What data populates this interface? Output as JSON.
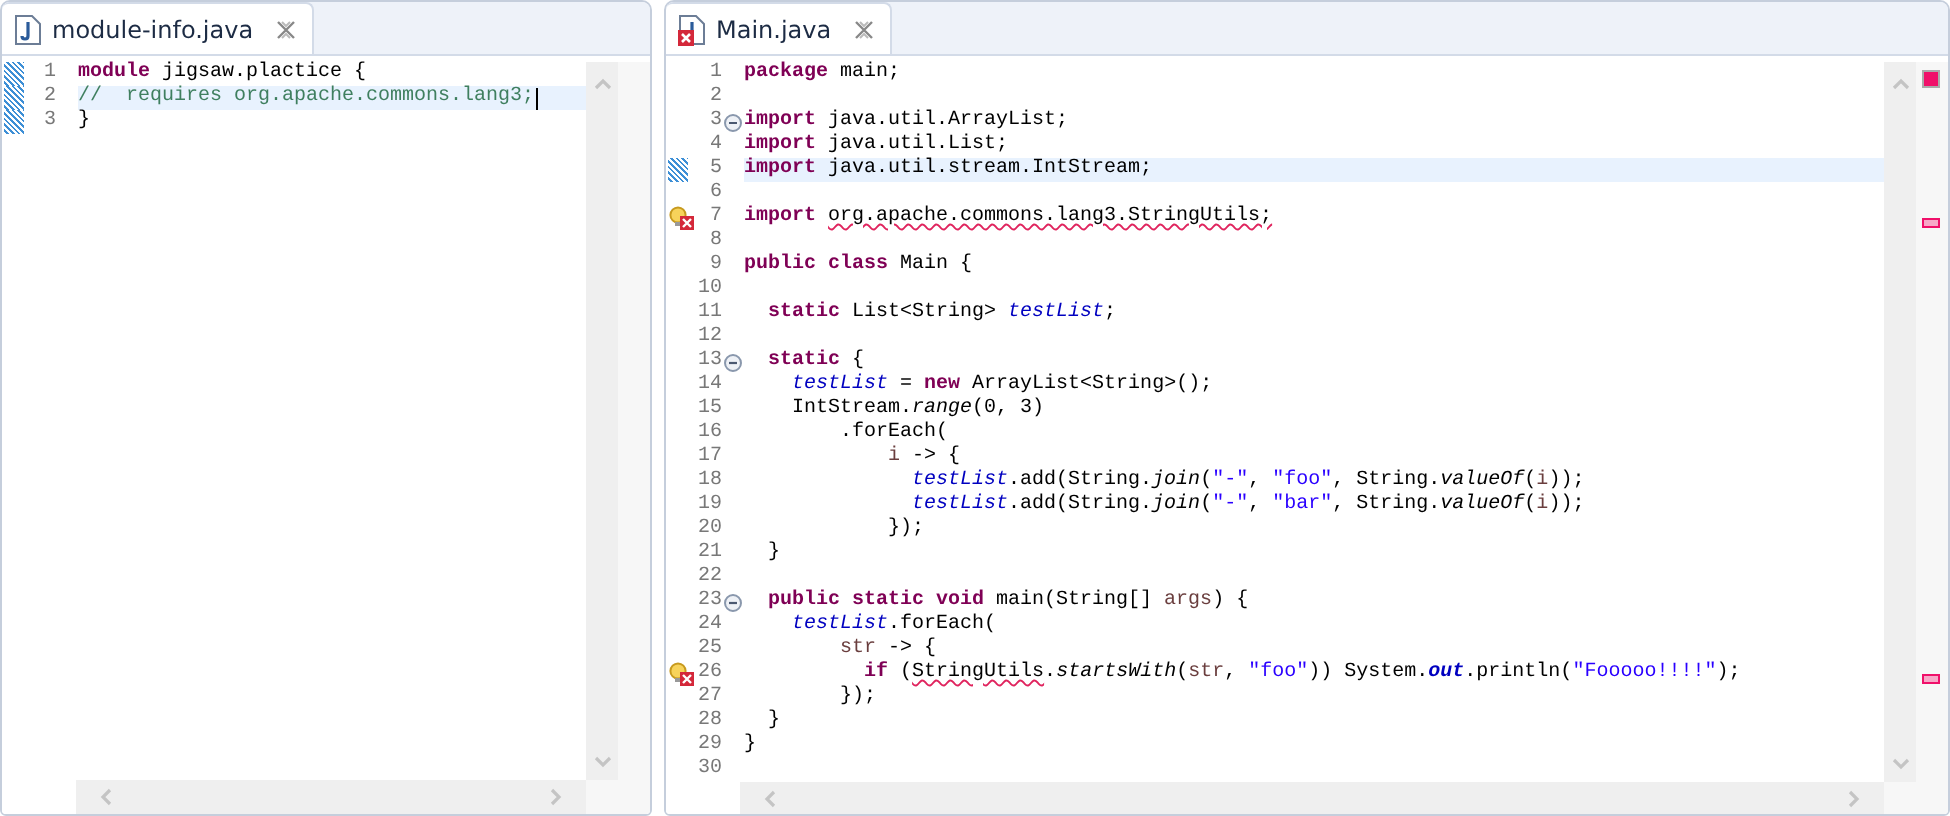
{
  "editors": [
    {
      "tab": {
        "title": "module-info.java",
        "has_error": false
      },
      "focused": true,
      "lines": [
        {
          "number": "1",
          "changed": true,
          "has_error": false,
          "fold": false,
          "current": false,
          "tokens": [
            {
              "text": "module",
              "kind": "keyword"
            },
            {
              "text": " jigsaw.plactice {",
              "kind": "plain"
            }
          ]
        },
        {
          "number": "2",
          "changed": true,
          "has_error": false,
          "fold": false,
          "current": true,
          "tokens": [
            {
              "text": "//  requires org.apache.commons.lang3;",
              "kind": "comment"
            }
          ]
        },
        {
          "number": "3",
          "changed": true,
          "has_error": false,
          "fold": false,
          "current": false,
          "tokens": [
            {
              "text": "}",
              "kind": "plain"
            }
          ]
        }
      ]
    },
    {
      "tab": {
        "title": "Main.java",
        "has_error": true
      },
      "focused": false,
      "lines": [
        {
          "number": "1",
          "changed": false,
          "has_error": false,
          "fold": false,
          "current": false,
          "tokens": [
            {
              "text": "package",
              "kind": "keyword"
            },
            {
              "text": " main;",
              "kind": "plain"
            }
          ]
        },
        {
          "number": "2",
          "changed": false,
          "has_error": false,
          "fold": false,
          "current": false
        },
        {
          "number": "3",
          "changed": false,
          "has_error": false,
          "fold": true,
          "current": false,
          "tokens": [
            {
              "text": "import",
              "kind": "keyword"
            },
            {
              "text": " java.util.ArrayList;",
              "kind": "plain"
            }
          ]
        },
        {
          "number": "4",
          "changed": false,
          "has_error": false,
          "fold": false,
          "current": false,
          "tokens": [
            {
              "text": "import",
              "kind": "keyword"
            },
            {
              "text": " java.util.List;",
              "kind": "plain"
            }
          ]
        },
        {
          "number": "5",
          "changed": true,
          "has_error": false,
          "fold": false,
          "current": true,
          "tokens": [
            {
              "text": "import",
              "kind": "keyword"
            },
            {
              "text": " java.util.stream.IntStream;",
              "kind": "plain"
            }
          ]
        },
        {
          "number": "6",
          "changed": false,
          "has_error": false,
          "fold": false,
          "current": false
        },
        {
          "number": "7",
          "changed": false,
          "has_error": true,
          "fold": false,
          "current": false,
          "tokens": [
            {
              "text": "import ",
              "kind": "keyword"
            },
            {
              "text": "org.apache.commons.lang3.StringUtils;",
              "kind": "error"
            }
          ]
        },
        {
          "number": "8",
          "changed": false,
          "has_error": false,
          "fold": false,
          "current": false
        },
        {
          "number": "9",
          "changed": false,
          "has_error": false,
          "fold": false,
          "current": false,
          "tokens": [
            {
              "text": "public class",
              "kind": "keyword"
            },
            {
              "text": " Main {",
              "kind": "plain"
            }
          ]
        },
        {
          "number": "10",
          "changed": false,
          "has_error": false,
          "fold": false,
          "current": false
        },
        {
          "number": "11",
          "changed": false,
          "has_error": false,
          "fold": false,
          "current": false,
          "tokens": [
            {
              "text": "  static",
              "kind": "keyword"
            },
            {
              "text": " List<String> ",
              "kind": "plain"
            },
            {
              "text": "testList",
              "kind": "field"
            },
            {
              "text": ";",
              "kind": "plain"
            }
          ]
        },
        {
          "number": "12",
          "changed": false,
          "has_error": false,
          "fold": false,
          "current": false
        },
        {
          "number": "13",
          "changed": false,
          "has_error": false,
          "fold": true,
          "current": false,
          "tokens": [
            {
              "text": "  static",
              "kind": "keyword"
            },
            {
              "text": " {",
              "kind": "plain"
            }
          ]
        },
        {
          "number": "14",
          "changed": false,
          "has_error": false,
          "fold": false,
          "current": false,
          "tokens": [
            {
              "text": "    testList",
              "kind": "field"
            },
            {
              "text": " = ",
              "kind": "plain"
            },
            {
              "text": "new",
              "kind": "keyword"
            },
            {
              "text": " ArrayList<String>();",
              "kind": "plain"
            }
          ]
        },
        {
          "number": "15",
          "changed": false,
          "has_error": false,
          "fold": false,
          "current": false,
          "tokens": [
            {
              "text": "    IntStream.",
              "kind": "plain"
            },
            {
              "text": "range",
              "kind": "static"
            },
            {
              "text": "(0, 3)",
              "kind": "plain"
            }
          ]
        },
        {
          "number": "16",
          "changed": false,
          "has_error": false,
          "fold": false,
          "current": false,
          "tokens": [
            {
              "text": "        .forEach(",
              "kind": "plain"
            }
          ]
        },
        {
          "number": "17",
          "changed": false,
          "has_error": false,
          "fold": false,
          "current": false,
          "tokens": [
            {
              "text": "            i",
              "kind": "local"
            },
            {
              "text": " -> {",
              "kind": "plain"
            }
          ]
        },
        {
          "number": "18",
          "changed": false,
          "has_error": false,
          "fold": false,
          "current": false,
          "tokens": [
            {
              "text": "              testList",
              "kind": "field"
            },
            {
              "text": ".add(String.",
              "kind": "plain"
            },
            {
              "text": "join",
              "kind": "static"
            },
            {
              "text": "(",
              "kind": "plain"
            },
            {
              "text": "\"-\"",
              "kind": "string"
            },
            {
              "text": ", ",
              "kind": "plain"
            },
            {
              "text": "\"foo\"",
              "kind": "string"
            },
            {
              "text": ", String.",
              "kind": "plain"
            },
            {
              "text": "valueOf",
              "kind": "static"
            },
            {
              "text": "(",
              "kind": "plain"
            },
            {
              "text": "i",
              "kind": "local"
            },
            {
              "text": "));",
              "kind": "plain"
            }
          ]
        },
        {
          "number": "19",
          "changed": false,
          "has_error": false,
          "fold": false,
          "current": false,
          "tokens": [
            {
              "text": "              testList",
              "kind": "field"
            },
            {
              "text": ".add(String.",
              "kind": "plain"
            },
            {
              "text": "join",
              "kind": "static"
            },
            {
              "text": "(",
              "kind": "plain"
            },
            {
              "text": "\"-\"",
              "kind": "string"
            },
            {
              "text": ", ",
              "kind": "plain"
            },
            {
              "text": "\"bar\"",
              "kind": "string"
            },
            {
              "text": ", String.",
              "kind": "plain"
            },
            {
              "text": "valueOf",
              "kind": "static"
            },
            {
              "text": "(",
              "kind": "plain"
            },
            {
              "text": "i",
              "kind": "local"
            },
            {
              "text": "));",
              "kind": "plain"
            }
          ]
        },
        {
          "number": "20",
          "changed": false,
          "has_error": false,
          "fold": false,
          "current": false,
          "tokens": [
            {
              "text": "            });",
              "kind": "plain"
            }
          ]
        },
        {
          "number": "21",
          "changed": false,
          "has_error": false,
          "fold": false,
          "current": false,
          "tokens": [
            {
              "text": "  }",
              "kind": "plain"
            }
          ]
        },
        {
          "number": "22",
          "changed": false,
          "has_error": false,
          "fold": false,
          "current": false
        },
        {
          "number": "23",
          "changed": false,
          "has_error": false,
          "fold": true,
          "current": false,
          "tokens": [
            {
              "text": "  public static void",
              "kind": "keyword"
            },
            {
              "text": " main(String[] ",
              "kind": "plain"
            },
            {
              "text": "args",
              "kind": "local"
            },
            {
              "text": ") {",
              "kind": "plain"
            }
          ]
        },
        {
          "number": "24",
          "changed": false,
          "has_error": false,
          "fold": false,
          "current": false,
          "tokens": [
            {
              "text": "    testList",
              "kind": "field"
            },
            {
              "text": ".forEach(",
              "kind": "plain"
            }
          ]
        },
        {
          "number": "25",
          "changed": false,
          "has_error": false,
          "fold": false,
          "current": false,
          "tokens": [
            {
              "text": "        str",
              "kind": "local"
            },
            {
              "text": " -> {",
              "kind": "plain"
            }
          ]
        },
        {
          "number": "26",
          "changed": false,
          "has_error": true,
          "fold": false,
          "current": false,
          "tokens": [
            {
              "text": "          if",
              "kind": "keyword"
            },
            {
              "text": " (",
              "kind": "plain"
            },
            {
              "text": "StringUtils",
              "kind": "error"
            },
            {
              "text": ".",
              "kind": "plain"
            },
            {
              "text": "startsWith",
              "kind": "static"
            },
            {
              "text": "(",
              "kind": "plain"
            },
            {
              "text": "str",
              "kind": "local"
            },
            {
              "text": ", ",
              "kind": "plain"
            },
            {
              "text": "\"foo\"",
              "kind": "string"
            },
            {
              "text": ")) System.",
              "kind": "plain"
            },
            {
              "text": "out",
              "kind": "static-field"
            },
            {
              "text": ".println(",
              "kind": "plain"
            },
            {
              "text": "\"Fooooo!!!!\"",
              "kind": "string"
            },
            {
              "text": ");",
              "kind": "plain"
            }
          ]
        },
        {
          "number": "27",
          "changed": false,
          "has_error": false,
          "fold": false,
          "current": false,
          "tokens": [
            {
              "text": "        });",
              "kind": "plain"
            }
          ]
        },
        {
          "number": "28",
          "changed": false,
          "has_error": false,
          "fold": false,
          "current": false,
          "tokens": [
            {
              "text": "  }",
              "kind": "plain"
            }
          ]
        },
        {
          "number": "29",
          "changed": false,
          "has_error": false,
          "fold": false,
          "current": false,
          "tokens": [
            {
              "text": "}",
              "kind": "plain"
            }
          ]
        },
        {
          "number": "30",
          "changed": false,
          "has_error": false,
          "fold": false,
          "current": false
        }
      ]
    }
  ]
}
